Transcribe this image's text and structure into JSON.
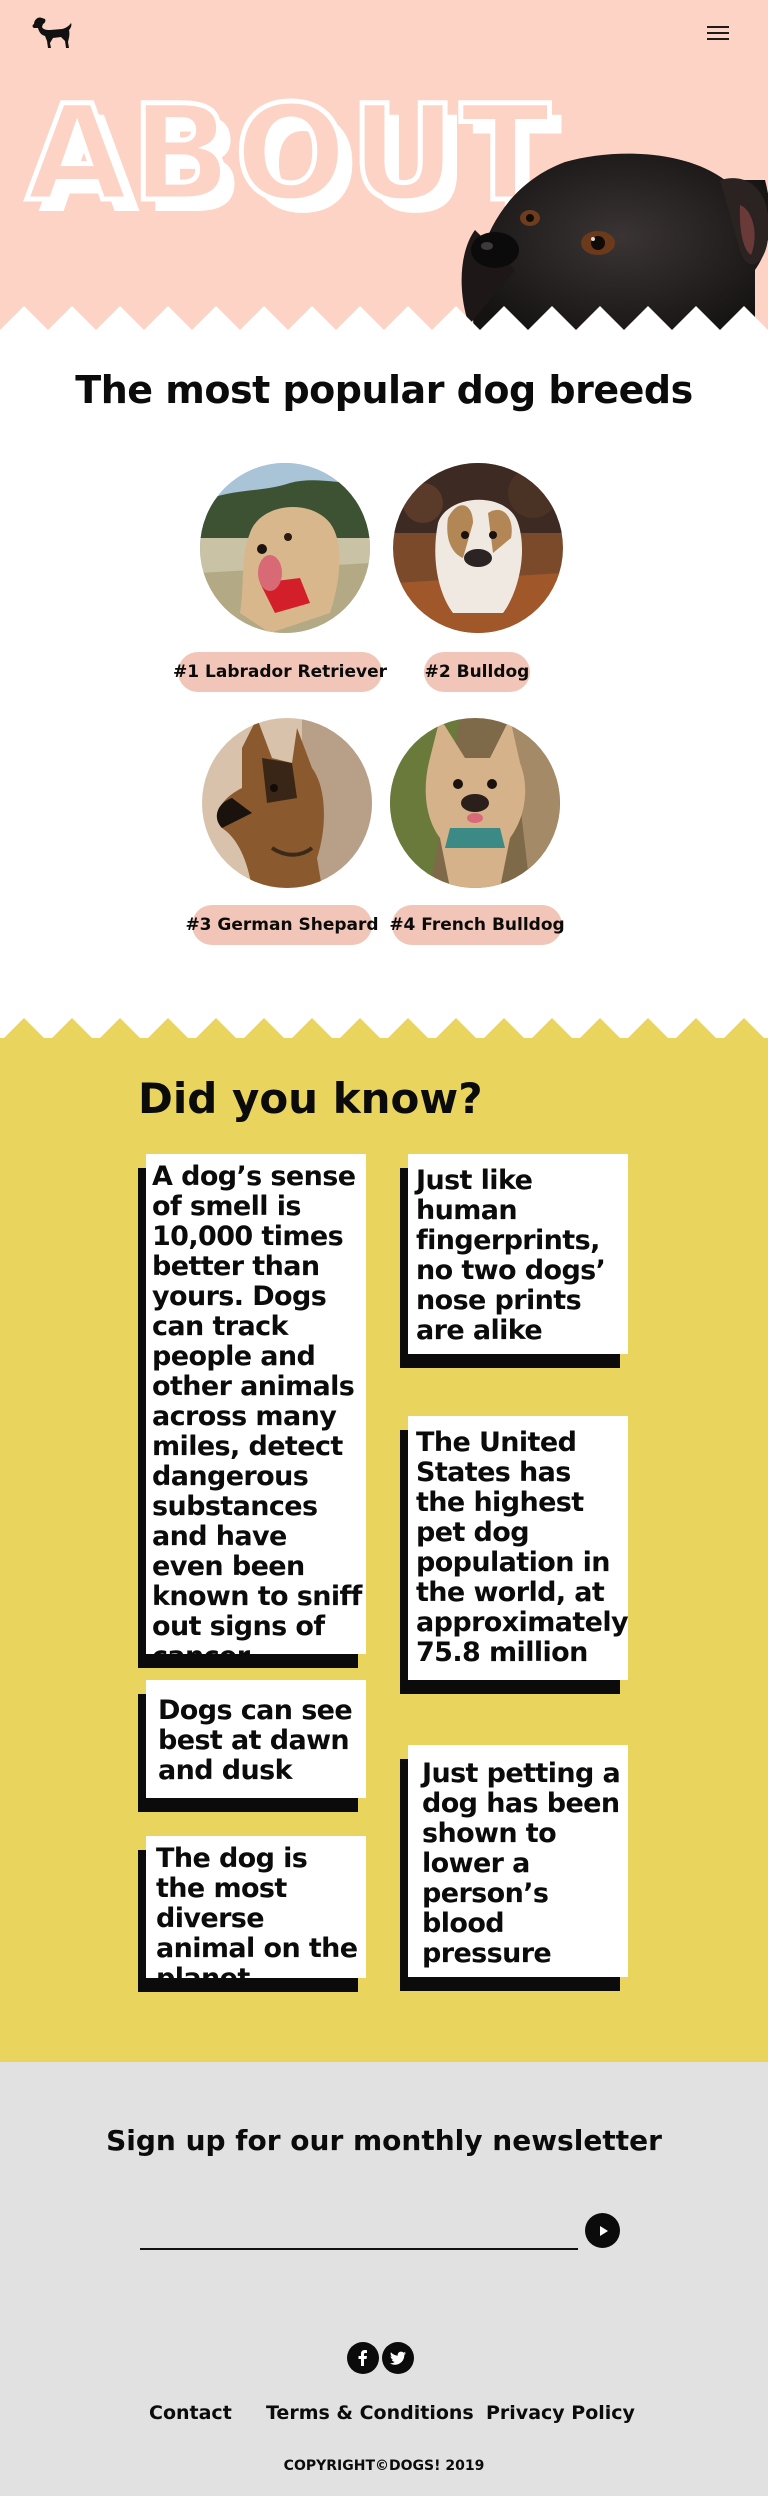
{
  "header": {
    "logo_icon": "dog-silhouette-icon",
    "menu_icon": "hamburger-menu-icon",
    "title": "ABOUT",
    "bg_color": "#fcd3c4"
  },
  "breeds": {
    "title": "The most popular dog breeds",
    "items": [
      {
        "label": "#1 Labrador Retriever"
      },
      {
        "label": "#2 Bulldog"
      },
      {
        "label": "#3 German Shepard"
      },
      {
        "label": "#4 French Bulldog"
      }
    ],
    "pill_color": "#f1c5b7"
  },
  "facts": {
    "title": "Did you know?",
    "bg_color": "#e9d45d",
    "items": [
      {
        "text": "A dog’s sense of smell is 10,000 times better than yours. Dogs can track people and other animals across many miles, detect dangerous substances and have even been known to sniff out signs of cancer."
      },
      {
        "text": "Just like human fingerprints, no two dogs’ nose prints are alike"
      },
      {
        "text": "The United States has the highest pet dog population in the world, at approximately 75.8 million"
      },
      {
        "text": "Dogs can see best at dawn and dusk"
      },
      {
        "text": "Just petting a dog has been shown to lower a person’s blood pressure"
      },
      {
        "text": "The dog is the most diverse animal on the planet"
      }
    ]
  },
  "newsletter": {
    "title": "Sign up for our monthly newsletter",
    "email_placeholder": "",
    "submit_icon": "arrow-right-icon"
  },
  "footer": {
    "social_icons": [
      "facebook-icon",
      "twitter-icon"
    ],
    "links": [
      "Contact",
      "Terms & Conditions",
      "Privacy Policy"
    ],
    "copyright": "COPYRIGHT©DOGS! 2019",
    "bg_color": "#e1e1e1"
  }
}
